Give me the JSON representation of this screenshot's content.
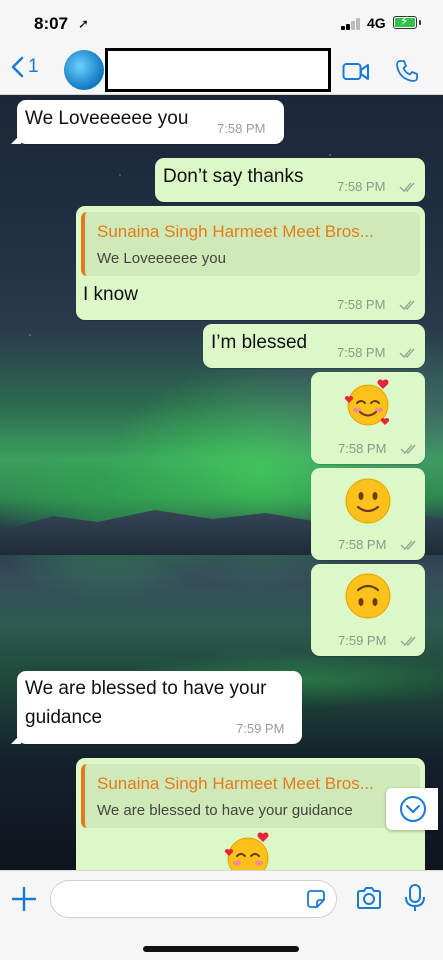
{
  "status_bar": {
    "time": "8:07",
    "network": "4G"
  },
  "header": {
    "back_count": "1",
    "contact_name": "",
    "avatar_text": ""
  },
  "messages": [
    {
      "dir": "in",
      "text": "We Loveeeeee you",
      "time": "7:58 PM"
    },
    {
      "dir": "out",
      "text": "Don’t say thanks",
      "time": "7:58 PM"
    },
    {
      "dir": "out",
      "reply_to": {
        "name": "Sunaina Singh Harmeet Meet Bros...",
        "text": "We Loveeeeee you"
      },
      "text": "I know",
      "time": "7:58 PM"
    },
    {
      "dir": "out",
      "text": "I’m blessed",
      "time": "7:58 PM"
    },
    {
      "dir": "out",
      "emoji": "smiling-face-with-hearts",
      "time": "7:58 PM"
    },
    {
      "dir": "out",
      "emoji": "slightly-smiling-face",
      "time": "7:58 PM"
    },
    {
      "dir": "out",
      "emoji": "upside-down-face",
      "time": "7:59 PM"
    },
    {
      "dir": "in",
      "text_lines": [
        "We are blessed to have your",
        "guidance"
      ],
      "time": "7:59 PM"
    },
    {
      "dir": "out",
      "reply_to": {
        "name": "Sunaina Singh Harmeet Meet Bros...",
        "text": "We are blessed to have your guidance"
      },
      "emoji": "smiling-face-with-hearts"
    }
  ],
  "input_bar": {
    "placeholder": "",
    "value": ""
  },
  "colors": {
    "accent": "#1a7bd3",
    "outgoing_bubble": "#dcf8c6",
    "incoming_bubble": "#ffffff",
    "quote_name": "#e37b1c"
  }
}
